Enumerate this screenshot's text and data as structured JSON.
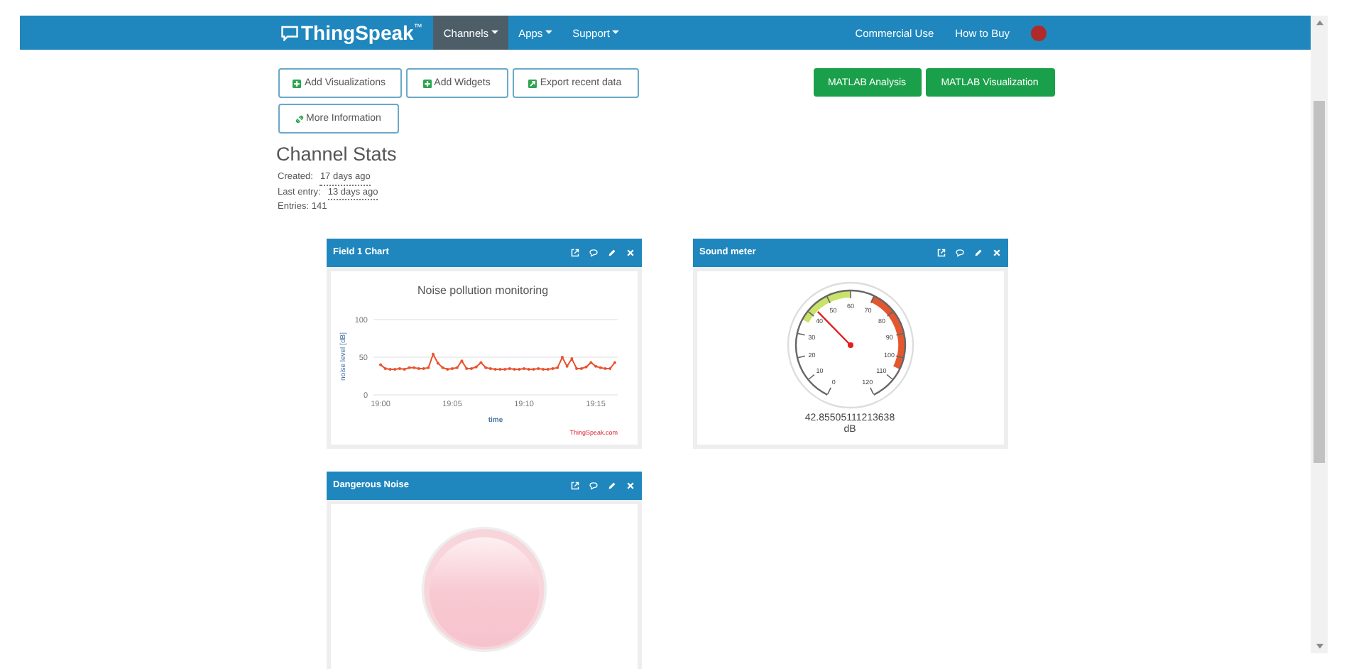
{
  "navbar": {
    "brand": "ThingSpeak",
    "brand_mark": "™",
    "menus": [
      {
        "label": "Channels",
        "selected": true
      },
      {
        "label": "Apps",
        "selected": false
      },
      {
        "label": "Support",
        "selected": false
      }
    ],
    "links": [
      "Commercial Use",
      "How to Buy"
    ]
  },
  "actions": [
    {
      "label": "Add Visualizations"
    },
    {
      "label": "Add Widgets"
    },
    {
      "label": "Export recent data"
    },
    {
      "label": "More Information"
    }
  ],
  "matlab_buttons": [
    "MATLAB Analysis",
    "MATLAB Visualization"
  ],
  "stats": {
    "title": "Channel Stats",
    "rows": [
      {
        "label": "Created:",
        "value": "17 days ago"
      },
      {
        "label": "Last entry:",
        "value": "13 days ago"
      },
      {
        "label": "Entries: 141"
      }
    ]
  },
  "widgets": [
    {
      "kind": "chart",
      "title": "Field 1 Chart",
      "credit": "ThingSpeak.com",
      "chart_data": {
        "type": "line",
        "title": "Noise pollution monitoring",
        "xlabel": "time",
        "ylabel": "noise level [dB]",
        "categories": [
          "19:00",
          null,
          null,
          null,
          null,
          null,
          null,
          null,
          null,
          null,
          null,
          null,
          null,
          null,
          null,
          "19:05",
          null,
          null,
          null,
          null,
          null,
          null,
          null,
          null,
          null,
          null,
          null,
          null,
          null,
          null,
          "19:10",
          null,
          null,
          null,
          null,
          null,
          null,
          null,
          null,
          null,
          null,
          null,
          null,
          null,
          null,
          "19:15",
          null,
          null,
          null,
          null
        ],
        "series": [
          {
            "color": "#e8522e",
            "values": [
              40,
              35,
              34,
              34,
              35,
              34,
              36,
              36,
              35,
              35,
              36,
              54,
              42,
              36,
              34,
              35,
              36,
              45,
              35,
              35,
              37,
              43,
              36,
              35,
              34,
              34,
              34,
              35,
              34,
              34,
              35,
              34,
              34,
              35,
              34,
              34,
              35,
              36,
              50,
              38,
              48,
              35,
              35,
              37,
              43,
              38,
              36,
              35,
              35,
              43
            ]
          }
        ],
        "ylim": [
          0,
          100
        ],
        "yticks": [
          0,
          50,
          100
        ]
      }
    },
    {
      "kind": "gauge",
      "title": "Sound meter",
      "scale": [
        "0",
        "10",
        "20",
        "30",
        "40",
        "50",
        "60",
        "70",
        "80",
        "90",
        "100",
        "110",
        "120"
      ],
      "level": 0.357,
      "reading": "42.85505111213638",
      "unit": "dB"
    },
    {
      "kind": "lamp",
      "title": "Dangerous Noise",
      "on": false
    }
  ]
}
